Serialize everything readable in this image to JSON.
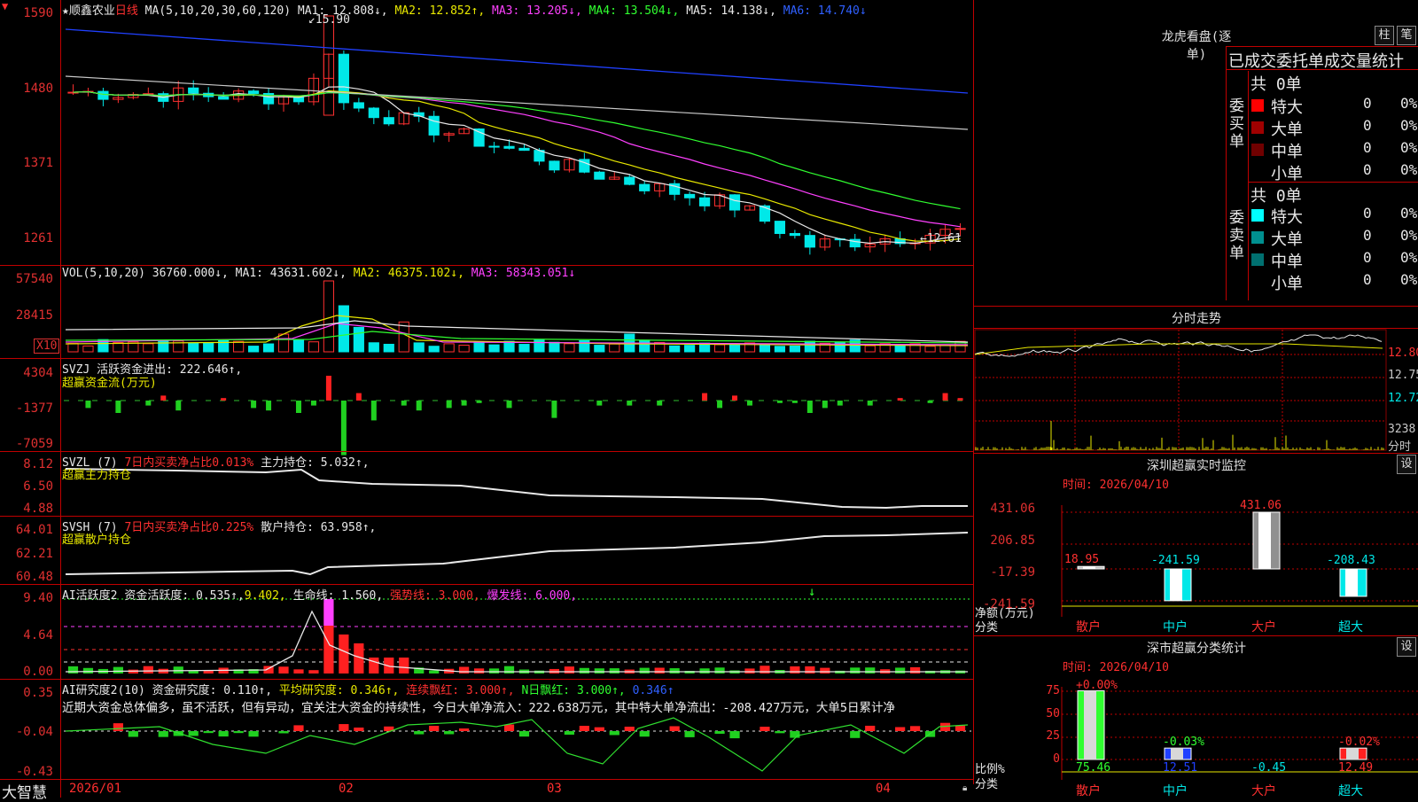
{
  "stock": {
    "title": "★顺鑫农业",
    "period": "日线",
    "ma_head": "MA(5,10,20,30,60,120)",
    "ma1": "MA1: 12.808↓,",
    "ma2": "MA2: 12.852↑,",
    "ma3": "MA3: 13.205↓,",
    "ma4": "MA4: 13.504↓,",
    "ma5": "MA5: 14.138↓,",
    "ma6": "MA6: 14.740↓",
    "high_mark": "15.90",
    "low_mark": "←12.61",
    "yticks": [
      "1590",
      "1480",
      "1371",
      "1261"
    ]
  },
  "vol": {
    "head": "VOL(5,10,20)",
    "value": "36760.000↓,",
    "ma1": "MA1: 43631.602↓,",
    "ma2": "MA2: 46375.102↓,",
    "ma3": "MA3: 58343.051↓",
    "yticks": [
      "57540",
      "28415",
      "X10"
    ]
  },
  "svzj": {
    "head": "SVZJ",
    "label": "活跃资金进出: 222.646↑,",
    "sub": "超赢资金流(万元)",
    "yticks": [
      "4304",
      "-1377",
      "-7059"
    ]
  },
  "svzl": {
    "head": "SVZL (7)",
    "ratio": "7日内买卖净占比0.013%",
    "label": "主力持仓: 5.032↑,",
    "sub": "超赢主力持仓",
    "yticks": [
      "8.12",
      "6.50",
      "4.88"
    ]
  },
  "svsh": {
    "head": "SVSH (7)",
    "ratio": "7日内买卖净占比0.225%",
    "label": "散户持仓: 63.958↑,",
    "sub": "超赢散户持仓",
    "yticks": [
      "64.01",
      "62.21",
      "60.48"
    ]
  },
  "ai1": {
    "head": "AI活跃度2",
    "label": "资金活跃度: 0.535↑,",
    "v2": "9.402,",
    "life": "生命线: 1.560,",
    "strong": "强势线: 3.000,",
    "burst": "爆发线: 6.000,",
    "yticks": [
      "9.40",
      "4.64",
      "0.00"
    ]
  },
  "ai2": {
    "head": "AI研究度2(10)",
    "label": "资金研究度: 0.110↑,",
    "avg": "平均研究度: 0.346↑,",
    "cont": "连续飘红: 3.000↑,",
    "nday": "N日飘红: 3.000↑,",
    "last": "0.346↑",
    "comment": "近期大资金总体偏多，虽不活跃，但有异动，宜关注大资金的持续性，今日大单净流入：222.638万元，其中特大单净流出：-208.427万元，大单5日累计净",
    "yticks": [
      "0.35",
      "-0.04",
      "-0.43"
    ]
  },
  "xaxis": {
    "labels": [
      "2026/01",
      "02",
      "03",
      "04"
    ],
    "brand": "大智慧"
  },
  "dragon": {
    "title": "龙虎看盘(逐单)",
    "btn1": "柱",
    "btn2": "笔",
    "heading": "已成交委托单成交量统计",
    "buy_side": "委买单",
    "sell_side": "委卖单",
    "buy_total": "共 0单",
    "sell_total": "共 0单",
    "buy_rows": [
      {
        "name": "特大",
        "n": "0",
        "pct": "0%",
        "color": "#ff0000"
      },
      {
        "name": "大单",
        "n": "0",
        "pct": "0%",
        "color": "#a00000"
      },
      {
        "name": "中单",
        "n": "0",
        "pct": "0%",
        "color": "#700000"
      },
      {
        "name": "小单",
        "n": "0",
        "pct": "0%",
        "color": ""
      }
    ],
    "sell_rows": [
      {
        "name": "特大",
        "n": "0",
        "pct": "0%",
        "color": "#00ffff"
      },
      {
        "name": "大单",
        "n": "0",
        "pct": "0%",
        "color": "#009090"
      },
      {
        "name": "中单",
        "n": "0",
        "pct": "0%",
        "color": "#007070"
      },
      {
        "name": "小单",
        "n": "0",
        "pct": "0%",
        "color": ""
      }
    ]
  },
  "intraday": {
    "title": "分时走势",
    "right": [
      "12.80",
      "12.75",
      "12.72",
      "3238",
      "分时"
    ]
  },
  "monitor": {
    "title": "深圳超赢实时监控",
    "set": "设",
    "time": "时间: 2026/04/10",
    "yticks": [
      "431.06",
      "206.85",
      "-17.39",
      "-241.59"
    ],
    "ylabel": "净额(万元)",
    "xlabel": "分类",
    "cats": [
      "散户",
      "中户",
      "大户",
      "超大"
    ],
    "vals": [
      "18.95",
      "-241.59",
      "431.06",
      "-208.43"
    ],
    "values": [
      18.95,
      -241.59,
      431.06,
      -208.43
    ]
  },
  "classify": {
    "title": "深市超赢分类统计",
    "set": "设",
    "time": "时间: 2026/04/10",
    "yticks": [
      "75",
      "50",
      "25",
      "0"
    ],
    "ylabel": "比例%",
    "xlabel": "分类",
    "cats": [
      "散户",
      "中户",
      "大户",
      "超大"
    ],
    "tops": [
      "+0.00%",
      "-0.03%",
      "",
      "-0.02%"
    ],
    "bottoms": [
      "75.46",
      "12.51",
      "-0.45",
      "12.49"
    ],
    "values": [
      75.46,
      12.51,
      0,
      12.49
    ]
  }
}
